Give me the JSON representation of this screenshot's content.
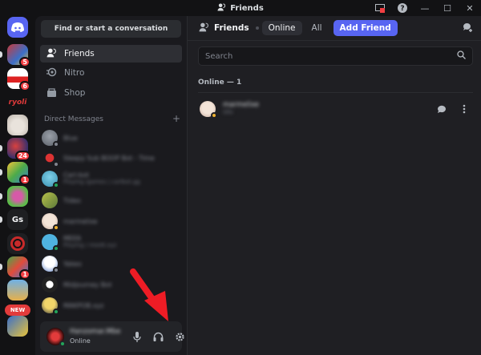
{
  "window": {
    "title": "Friends"
  },
  "servers": [
    {
      "name": "discord-home",
      "badge": ""
    },
    {
      "name": "server-1",
      "badge": "5"
    },
    {
      "name": "server-2",
      "badge": "6"
    },
    {
      "name": "server-ryoli",
      "label": "ryoli",
      "badge": ""
    },
    {
      "name": "server-4",
      "badge": ""
    },
    {
      "name": "server-5",
      "badge": "24"
    },
    {
      "name": "server-6",
      "badge": "1"
    },
    {
      "name": "server-7",
      "badge": ""
    },
    {
      "name": "server-gs",
      "label": "Gs",
      "badge": ""
    },
    {
      "name": "server-9",
      "badge": ""
    },
    {
      "name": "server-10",
      "badge": "1"
    },
    {
      "name": "server-11",
      "badge": ""
    },
    {
      "name": "server-new",
      "label": "NEW",
      "badge": ""
    }
  ],
  "sidebar": {
    "search_label": "Find or start a conversation",
    "nav": [
      {
        "label": "Friends",
        "icon": "friends-icon"
      },
      {
        "label": "Nitro",
        "icon": "nitro-icon"
      },
      {
        "label": "Shop",
        "icon": "shop-icon"
      }
    ],
    "dm_header": "Direct Messages",
    "dm_add": "+",
    "dms": [
      {
        "name": "Blue",
        "sub": ""
      },
      {
        "name": "Sleepy Sub BOOP Bot - Time",
        "sub": ""
      },
      {
        "name": "Carl-bot",
        "sub": "Playing /games | carlbot.gg"
      },
      {
        "name": "Tideo",
        "sub": ""
      },
      {
        "name": "marmelixe",
        "sub": ""
      },
      {
        "name": "MEE6",
        "sub": "Playing / mee6.xyz"
      },
      {
        "name": "Yakeo",
        "sub": ""
      },
      {
        "name": "Midjourney Bot",
        "sub": ""
      },
      {
        "name": "MAKPOB.xyz",
        "sub": ""
      }
    ]
  },
  "user": {
    "name": "Hanzomar.Mbe",
    "status": "Online"
  },
  "main": {
    "friends_label": "Friends",
    "tabs": [
      "Online",
      "All"
    ],
    "add_friend": "Add Friend",
    "search_placeholder": "Search",
    "online_count": "Online — 1",
    "friend": {
      "name": "marmelixe",
      "status": "Idle"
    }
  },
  "colors": {
    "accent": "#5865f2",
    "online": "#23a55a",
    "badge": "#f23f43",
    "arrow": "#ee1c25"
  }
}
